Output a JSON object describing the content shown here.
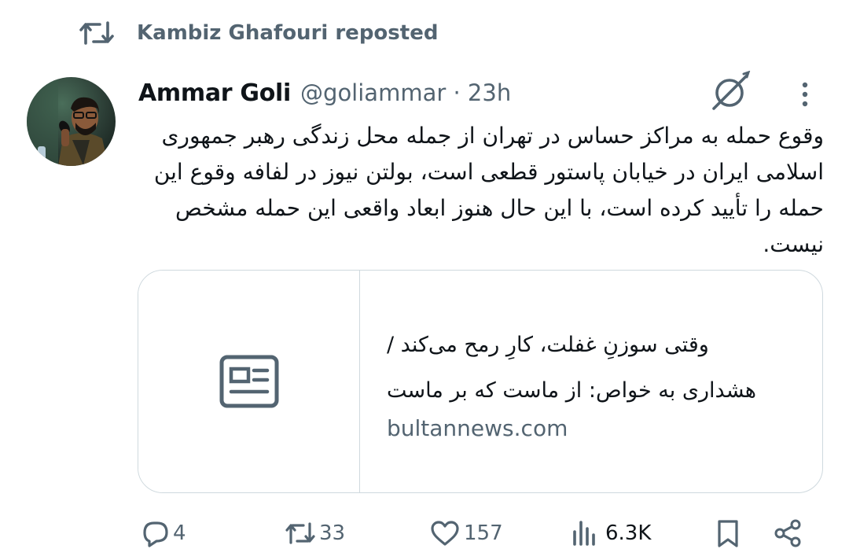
{
  "repost": {
    "text": "Kambiz Ghafouri reposted",
    "icon": "repost-icon"
  },
  "author": {
    "name": "Ammar Goli",
    "handle_time": "@goliammar · 23h"
  },
  "tweet": {
    "text": "وقوع حمله به مراکز حساس در تهران از جمله محل زندگی رهبر جمهوری اسلامی ایران در خیابان پاستور قطعی است، بولتن نیوز در لفافه وقوع این حمله را تأیید کرده است، با این حال هنوز ابعاد واقعی این حمله مشخص نیست."
  },
  "card": {
    "title_line1": "وقتی سوزنِ غفلت، کارِ رمح می‌کند /",
    "title_line2": "هشداری به خواص: از ماست که بر ماست",
    "domain": "bultannews.com",
    "thumb_icon": "article-icon"
  },
  "actions": {
    "replies": "4",
    "reposts": "33",
    "likes": "157",
    "views": "6.3K"
  },
  "colors": {
    "text": "#0f1419",
    "secondary": "#536471",
    "border": "#cfd9de"
  }
}
